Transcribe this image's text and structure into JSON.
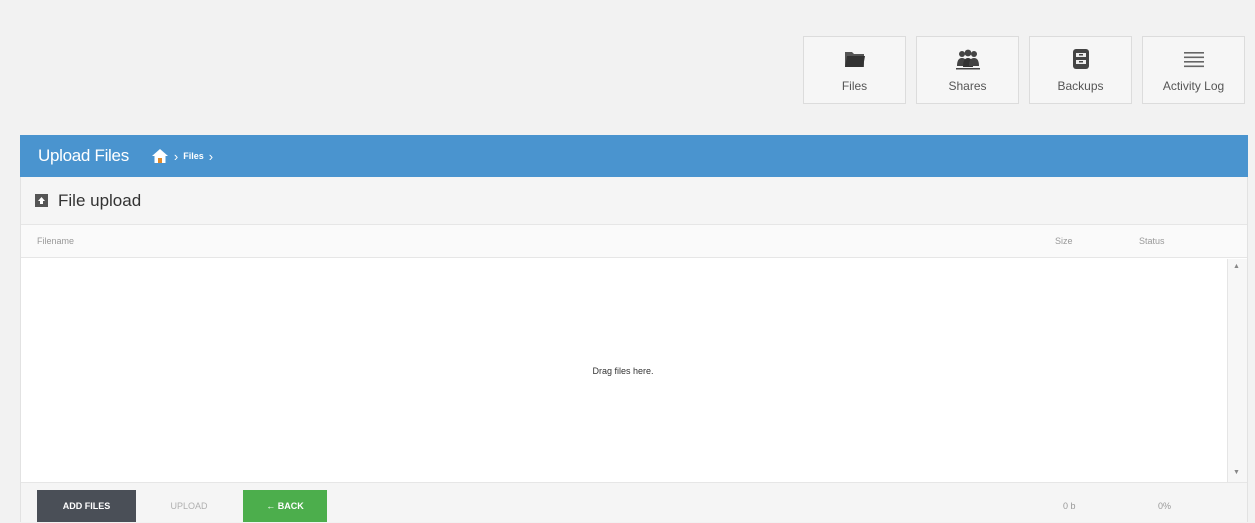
{
  "nav": [
    {
      "label": "Files",
      "icon": "folder-icon"
    },
    {
      "label": "Shares",
      "icon": "users-icon"
    },
    {
      "label": "Backups",
      "icon": "archive-icon"
    },
    {
      "label": "Activity Log",
      "icon": "list-icon"
    }
  ],
  "header": {
    "title": "Upload Files",
    "breadcrumb": [
      "Files"
    ],
    "bg_color": "#4a94cf"
  },
  "panel": {
    "title": "File upload",
    "columns": {
      "filename": "Filename",
      "size": "Size",
      "status": "Status"
    },
    "drop_message": "Drag files here."
  },
  "footer": {
    "add_files": "ADD FILES",
    "upload": "UPLOAD",
    "back": "← BACK",
    "total_size": "0 b",
    "progress": "0%"
  }
}
